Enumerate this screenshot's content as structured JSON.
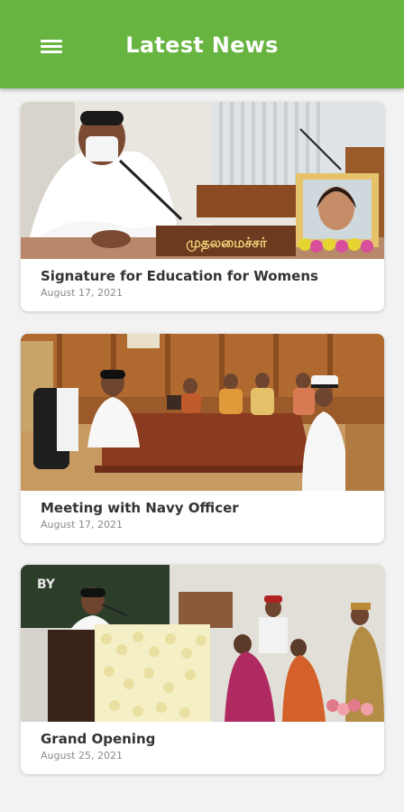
{
  "header": {
    "title": "Latest News",
    "menu_icon": "hamburger-menu-icon",
    "background_color": "#67b540"
  },
  "news": [
    {
      "headline": "Signature for Education for Womens",
      "date": "August 17, 2021",
      "photo_sign": "முதலமைச்சர்"
    },
    {
      "headline": "Meeting with Navy Officer",
      "date": "August 17, 2021"
    },
    {
      "headline": "Grand Opening",
      "date": "August 25, 2021",
      "banner_text": "BY"
    }
  ]
}
